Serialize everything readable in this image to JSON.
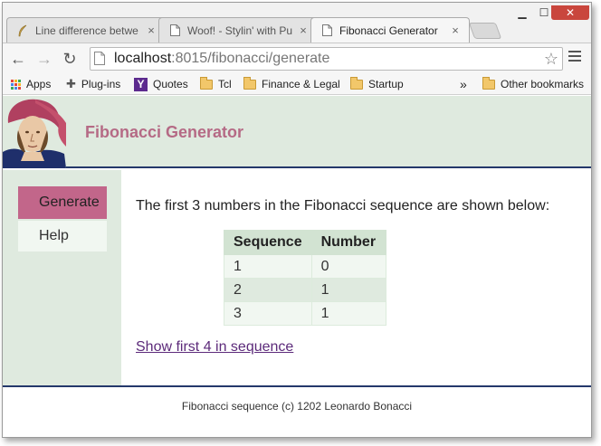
{
  "browser": {
    "tabs": [
      {
        "title": "Line difference betwe",
        "icon": "feather-icon",
        "active": false
      },
      {
        "title": "Woof! - Stylin' with Pu",
        "icon": "page-icon",
        "active": false
      },
      {
        "title": "Fibonacci Generator",
        "icon": "page-icon",
        "active": true
      }
    ],
    "tab_close": "×",
    "window_controls": {
      "minimize": "▁",
      "maximize": "☐",
      "close": "✕"
    },
    "nav": {
      "back": "←",
      "forward": "→",
      "reload": "↻"
    },
    "url": {
      "host": "localhost",
      "rest": ":8015/fibonacci/generate"
    },
    "star": "☆",
    "bookmarks": [
      {
        "label": "Apps",
        "icon": "apps-grid-icon"
      },
      {
        "label": "Plug-ins",
        "icon": "puzzle-icon"
      },
      {
        "label": "Quotes",
        "icon": "yahoo-icon"
      },
      {
        "label": "Tcl",
        "icon": "folder-icon"
      },
      {
        "label": "Finance & Legal",
        "icon": "folder-icon"
      },
      {
        "label": "Startup",
        "icon": "folder-icon"
      }
    ],
    "bookmarks_overflow": "»",
    "other_bookmarks": "Other bookmarks",
    "yahoo_letter": "Y",
    "puzzle_glyph": "✚"
  },
  "page": {
    "title": "Fibonacci Generator",
    "nav": [
      {
        "label": "Generate",
        "active": true
      },
      {
        "label": "Help",
        "active": false
      }
    ],
    "intro": "The first 3 numbers in the Fibonacci sequence are shown below:",
    "table": {
      "headers": [
        "Sequence",
        "Number"
      ],
      "rows": [
        [
          "1",
          "0"
        ],
        [
          "2",
          "1"
        ],
        [
          "3",
          "1"
        ]
      ]
    },
    "link": "Show first 4 in sequence",
    "footer": "Fibonacci sequence (c) 1202 Leonardo Bonacci"
  },
  "colors": {
    "header_bg": "#dfeadf",
    "title": "#b56a85",
    "nav_active": "#c2668a",
    "rule": "#24386b",
    "link": "#5c2a7a"
  }
}
